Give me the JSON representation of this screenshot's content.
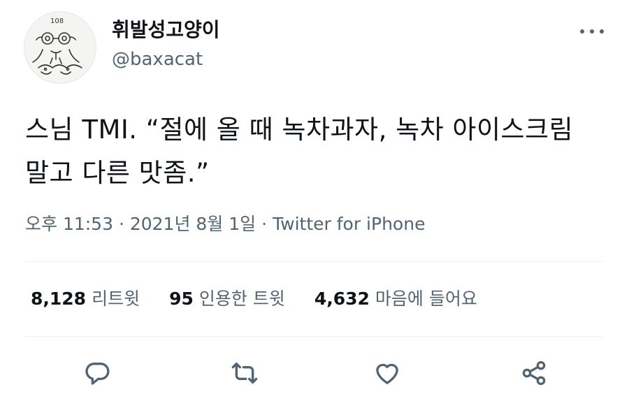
{
  "author": {
    "display_name": "휘발성고양이",
    "handle": "@baxacat",
    "avatar_icon": "doodle-cat-avatar"
  },
  "tweet": {
    "text": "스님 TMI. “절에 올 때 녹차과자, 녹차 아이스크림 말고 다른 맛좀.”",
    "timestamp": "오후 11:53 · 2021년 8월 1일 · Twitter for iPhone"
  },
  "stats": [
    {
      "count": "8,128",
      "label": "리트윗"
    },
    {
      "count": "95",
      "label": "인용한 트윗"
    },
    {
      "count": "4,632",
      "label": "마음에 들어요"
    }
  ],
  "actions": [
    "reply-icon",
    "retweet-icon",
    "like-icon",
    "share-icon"
  ],
  "colors": {
    "text": "#0f1419",
    "secondary": "#536471",
    "divider": "#eff3f4"
  }
}
